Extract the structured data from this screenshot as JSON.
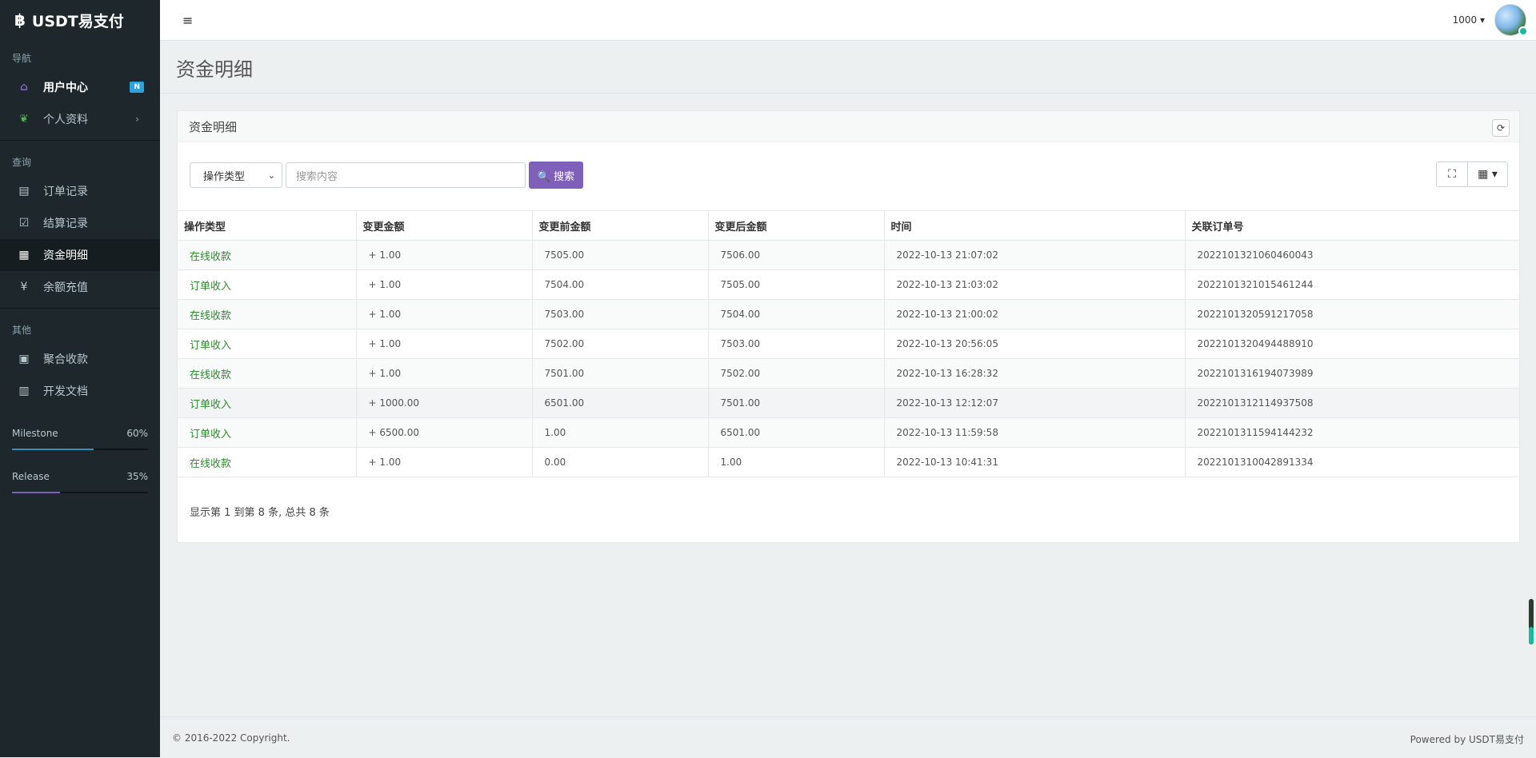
{
  "brand": {
    "logo": "฿",
    "name": "USDT易支付"
  },
  "sidebar": {
    "sections": [
      {
        "header": "导航",
        "items": [
          {
            "label": "用户中心",
            "icon": "home-icon",
            "glyph": "⌂",
            "badge": "N"
          },
          {
            "label": "个人资料",
            "icon": "leaf-icon",
            "glyph": "❦",
            "chevron": "›"
          }
        ]
      },
      {
        "header": "查询",
        "items": [
          {
            "label": "订单记录",
            "icon": "list-icon",
            "glyph": "▤"
          },
          {
            "label": "结算记录",
            "icon": "check-square-icon",
            "glyph": "☑"
          },
          {
            "label": "资金明细",
            "icon": "calendar-icon",
            "glyph": "▦"
          },
          {
            "label": "余额充值",
            "icon": "yen-icon",
            "glyph": "¥"
          }
        ]
      },
      {
        "header": "其他",
        "items": [
          {
            "label": "聚合收款",
            "icon": "qrcode-icon",
            "glyph": "▣"
          },
          {
            "label": "开发文档",
            "icon": "book-icon",
            "glyph": "▥"
          }
        ]
      }
    ],
    "progress": [
      {
        "label": "Milestone",
        "percent_text": "60%",
        "value": 0.6,
        "color": "#3c8dbc"
      },
      {
        "label": "Release",
        "percent_text": "35%",
        "value": 0.35,
        "color": "#7e5fba"
      }
    ]
  },
  "header": {
    "menu_icon": "≡",
    "user": "1000 ▾"
  },
  "page": {
    "title": "资金明细"
  },
  "panel": {
    "title": "资金明细",
    "refresh_glyph": "⟳",
    "filter_select": "操作类型",
    "search_placeholder": "搜索内容",
    "search_button": "🔍 搜索",
    "fullscreen_glyph": "⛶",
    "columns_glyph": "▦ ▾",
    "columns": [
      "操作类型",
      "变更金额",
      "变更前金额",
      "变更后金额",
      "时间",
      "关联订单号"
    ],
    "rows": [
      [
        "在线收款",
        "+ 1.00",
        "7505.00",
        "7506.00",
        "2022-10-13 21:07:02",
        "2022101321060460043"
      ],
      [
        "订单收入",
        "+ 1.00",
        "7504.00",
        "7505.00",
        "2022-10-13 21:03:02",
        "2022101321015461244"
      ],
      [
        "在线收款",
        "+ 1.00",
        "7503.00",
        "7504.00",
        "2022-10-13 21:00:02",
        "2022101320591217058"
      ],
      [
        "订单收入",
        "+ 1.00",
        "7502.00",
        "7503.00",
        "2022-10-13 20:56:05",
        "2022101320494488910"
      ],
      [
        "在线收款",
        "+ 1.00",
        "7501.00",
        "7502.00",
        "2022-10-13 16:28:32",
        "2022101316194073989"
      ],
      [
        "订单收入",
        "+ 1000.00",
        "6501.00",
        "7501.00",
        "2022-10-13 12:12:07",
        "2022101312114937508"
      ],
      [
        "订单收入",
        "+ 6500.00",
        "1.00",
        "6501.00",
        "2022-10-13 11:59:58",
        "2022101311594144232"
      ],
      [
        "在线收款",
        "+ 1.00",
        "0.00",
        "1.00",
        "2022-10-13 10:41:31",
        "2022101310042891334"
      ]
    ],
    "pager_info": "显示第 1 到第 8 条, 总共 8 条"
  },
  "footer": {
    "copyright": "© 2016-2022 Copyright.",
    "powered": "Powered by USDT易支付"
  }
}
